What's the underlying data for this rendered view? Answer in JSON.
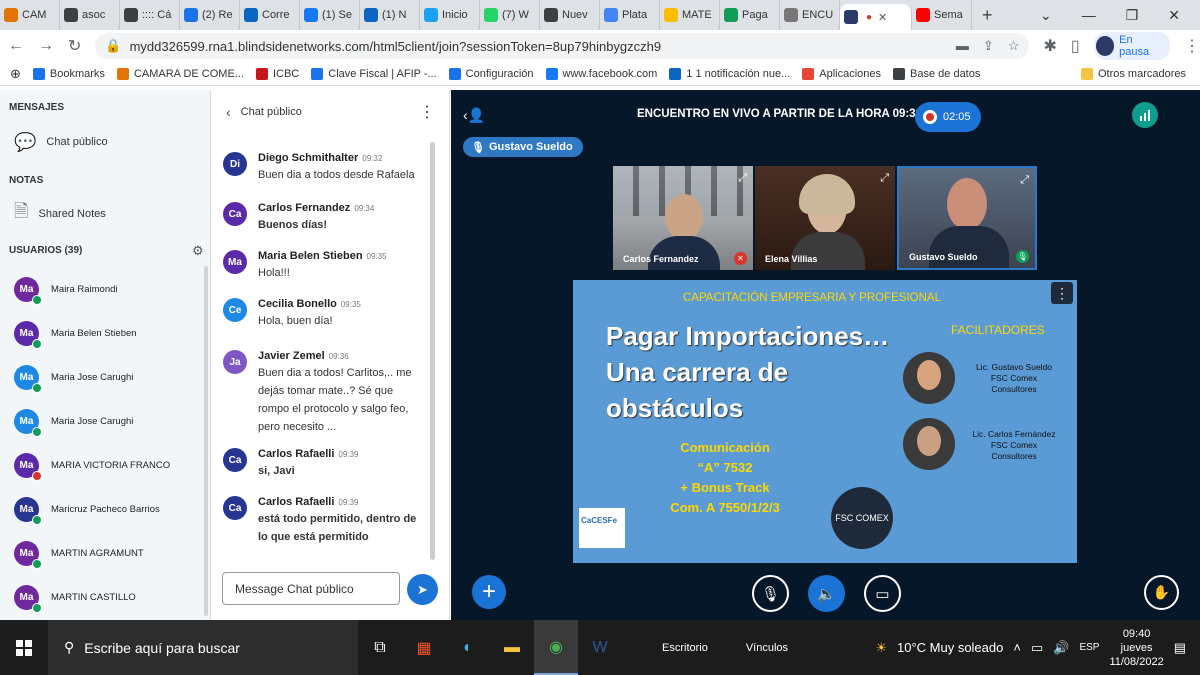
{
  "browser": {
    "tabs": [
      {
        "label": "CAM",
        "color": "#e37400"
      },
      {
        "label": "asoc",
        "color": "#3c4043"
      },
      {
        "label": ":::: Cá",
        "color": "#3c4043"
      },
      {
        "label": "(2) Re",
        "color": "#1a73e8"
      },
      {
        "label": "Corre",
        "color": "#0a66c2"
      },
      {
        "label": "(1) Se",
        "color": "#1877f2"
      },
      {
        "label": "(1) N",
        "color": "#0a66c2"
      },
      {
        "label": "Inicio",
        "color": "#1da1f2"
      },
      {
        "label": "(7) W",
        "color": "#25d366"
      },
      {
        "label": "Nuev",
        "color": "#3c4043"
      },
      {
        "label": "Plata",
        "color": "#4285f4"
      },
      {
        "label": "MATE",
        "color": "#fbbc04"
      },
      {
        "label": "Paga",
        "color": "#0f9d58"
      },
      {
        "label": "ENCU",
        "color": "#777777"
      },
      {
        "label": "",
        "color": "#2b3a67"
      },
      {
        "label": "Sema",
        "color": "#ff0000"
      }
    ],
    "url": "mydd326599.rna1.blindsidenetworks.com/html5client/join?sessionToken=8up79hinbygzczh9",
    "profile_label": "En pausa",
    "bookmarks": [
      {
        "label": "Bookmarks",
        "color": "#1a73e8"
      },
      {
        "label": "CAMARA DE COME...",
        "color": "#e37400"
      },
      {
        "label": "ICBC",
        "color": "#c4161c"
      },
      {
        "label": "Clave Fiscal | AFIP -...",
        "color": "#1a73e8"
      },
      {
        "label": "Configuración",
        "color": "#1a73e8"
      },
      {
        "label": "www.facebook.com",
        "color": "#1877f2"
      },
      {
        "label": "1 1 notificación nue...",
        "color": "#0a66c2"
      },
      {
        "label": "Aplicaciones",
        "color": "#ea4335"
      },
      {
        "label": "Base de datos",
        "color": "#3c4043"
      }
    ],
    "other_bookmarks": "Otros marcadores"
  },
  "sidebar": {
    "messages_header": "MENSAJES",
    "public_chat": "Chat público",
    "notes_header": "NOTAS",
    "shared_notes": "Shared Notes",
    "users_header": "USUARIOS (39)",
    "users": [
      {
        "initials": "Ma",
        "name": "Maira Raimondi",
        "color": "#6e2a9c",
        "status": "green"
      },
      {
        "initials": "Ma",
        "name": "Maria Belen Stieben",
        "color": "#5b2aa8",
        "status": "green"
      },
      {
        "initials": "Ma",
        "name": "Maria Jose Carughi",
        "color": "#1e88e5",
        "status": "green"
      },
      {
        "initials": "Ma",
        "name": "Maria Jose Carughi",
        "color": "#1e88e5",
        "status": "green"
      },
      {
        "initials": "Ma",
        "name": "MARIA VICTORIA FRANCO",
        "color": "#5b2aa8",
        "status": "red"
      },
      {
        "initials": "Ma",
        "name": "Maricruz Pacheco Barrios",
        "color": "#283593",
        "status": "green"
      },
      {
        "initials": "Ma",
        "name": "MARTIN AGRAMUNT",
        "color": "#6e2a9c",
        "status": "green"
      },
      {
        "initials": "Ma",
        "name": "MARTIN CASTILLO",
        "color": "#6e2a9c",
        "status": "green"
      }
    ]
  },
  "chat": {
    "title": "Chat público",
    "input_placeholder": "Message Chat público",
    "messages": [
      {
        "initials": "Di",
        "name": "Diego Schmithalter",
        "time": "09:32",
        "text": "Buen dia a todos desde Rafaela",
        "color": "#283593",
        "bold": false
      },
      {
        "initials": "Ca",
        "name": "Carlos Fernandez",
        "time": "09:34",
        "text": "Buenos días!",
        "color": "#5b2aa8",
        "bold": true
      },
      {
        "initials": "Ma",
        "name": "Maria Belen Stieben",
        "time": "09:35",
        "text": "Hola!!!",
        "color": "#5b2aa8",
        "bold": false
      },
      {
        "initials": "Ce",
        "name": "Cecilia Bonello",
        "time": "09:35",
        "text": "Hola, buen día!",
        "color": "#1e88e5",
        "bold": false
      },
      {
        "initials": "Ja",
        "name": "Javier Zemel",
        "time": "09:36",
        "text": "Buen dia a todos! Carlitos,.. me dejás tomar mate..? Sé que rompo el protocolo y salgo feo, pero necesito ...",
        "color": "#7e57c2",
        "bold": false
      },
      {
        "initials": "Ca",
        "name": "Carlos Rafaelli",
        "time": "09:39",
        "text": "si, Javi",
        "color": "#283593",
        "bold": true
      },
      {
        "initials": "Ca",
        "name": "Carlos Rafaelli",
        "time": "09:39",
        "text": "está todo permitido, dentro de lo que está permitido",
        "color": "#283593",
        "bold": true
      }
    ]
  },
  "meeting": {
    "title": "ENCUENTRO EN VIVO A PARTIR DE LA HORA 09:30",
    "recording_time": "02:05",
    "talking": "Gustavo Sueldo",
    "videos": [
      {
        "name": "Carlos Fernandez",
        "mic": "muted"
      },
      {
        "name": "Elena Villias",
        "mic": "none"
      },
      {
        "name": "Gustavo Sueldo",
        "mic": "active"
      }
    ]
  },
  "slide": {
    "header": "CAPACITACIÓN  EMPRESARIA Y PROFESIONAL",
    "title_line1": "Pagar Importaciones…",
    "title_line2": "Una carrera de",
    "title_line3": "obstáculos",
    "facilitators_label": "FACILITADORES",
    "facilitator1": [
      "Lic. Gustavo Sueldo",
      "FSC Comex",
      "Consultores"
    ],
    "facilitator2": [
      "Lic. Carlos Fernández",
      "FSC Comex",
      "Consultores"
    ],
    "com_line1": "Comunicación",
    "com_line2": "“A” 7532",
    "com_line3": "+ Bonus Track",
    "com_line4": "Com. A 7550/1/2/3",
    "logo_left": "CaCESFe",
    "logo_right": "FSC COMEX"
  },
  "taskbar": {
    "search_placeholder": "Escribe aquí para buscar",
    "desktop": "Escritorio",
    "links": "Vínculos",
    "weather": "10°C  Muy soleado",
    "lang": "ESP",
    "time": "09:40",
    "day": "jueves",
    "date": "11/08/2022"
  }
}
